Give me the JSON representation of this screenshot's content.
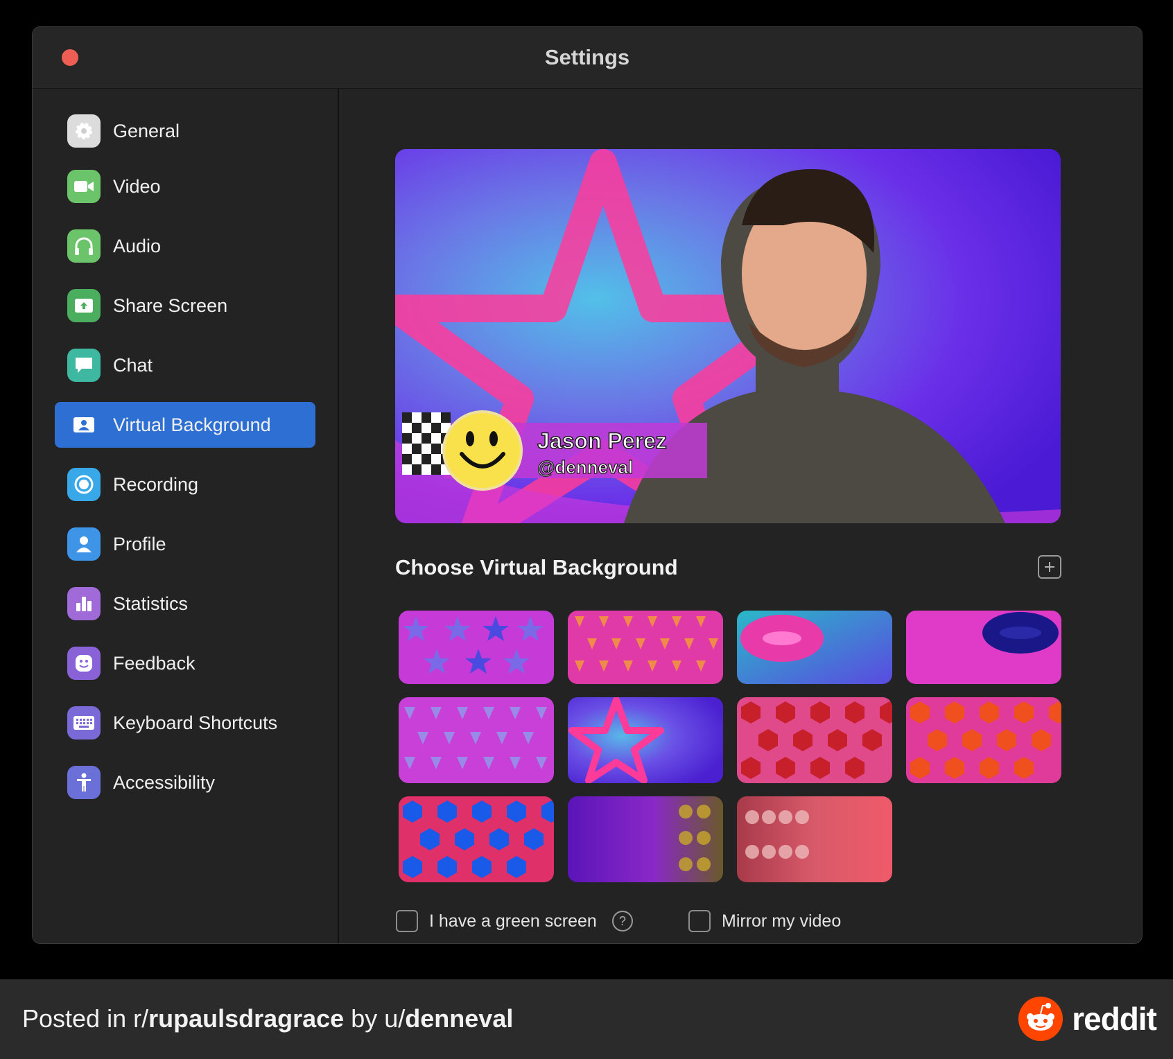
{
  "window": {
    "title": "Settings"
  },
  "sidebar": {
    "items": [
      {
        "label": "General",
        "icon": "gear-icon",
        "color": "#e0e0e0"
      },
      {
        "label": "Video",
        "icon": "video-camera-icon",
        "color": "#6cc46a"
      },
      {
        "label": "Audio",
        "icon": "headphones-icon",
        "color": "#6cc46a"
      },
      {
        "label": "Share Screen",
        "icon": "share-screen-icon",
        "color": "#4aae5e"
      },
      {
        "label": "Chat",
        "icon": "chat-bubble-icon",
        "color": "#3fb8a2"
      },
      {
        "label": "Virtual Background",
        "icon": "person-card-icon",
        "color": "#2e6fd3",
        "active": true
      },
      {
        "label": "Recording",
        "icon": "record-icon",
        "color": "#38a8e8"
      },
      {
        "label": "Profile",
        "icon": "profile-icon",
        "color": "#3e95e8"
      },
      {
        "label": "Statistics",
        "icon": "bar-chart-icon",
        "color": "#a06ad8"
      },
      {
        "label": "Feedback",
        "icon": "smiley-icon",
        "color": "#8a62d8"
      },
      {
        "label": "Keyboard Shortcuts",
        "icon": "keyboard-icon",
        "color": "#7a6ad8"
      },
      {
        "label": "Accessibility",
        "icon": "accessibility-icon",
        "color": "#6a70d8"
      }
    ]
  },
  "preview": {
    "name": "Jason Perez",
    "handle": "@denneval"
  },
  "backgrounds": {
    "title": "Choose Virtual Background",
    "add_icon": "plus-square-icon"
  },
  "options": {
    "green_screen_label": "I have a green screen",
    "mirror_label": "Mirror my video"
  },
  "footer": {
    "posted_prefix": "Posted in r/",
    "subreddit": "rupaulsdragrace",
    "by_text": " by u/",
    "user": "denneval",
    "brand": "reddit",
    "brand_color": "#ff4500"
  }
}
